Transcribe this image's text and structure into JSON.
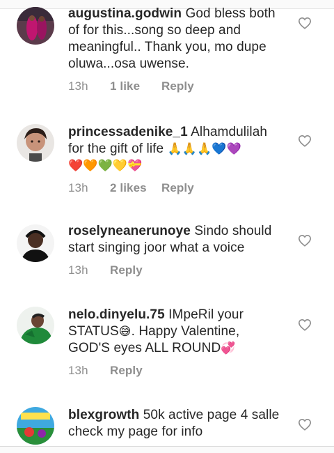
{
  "comments": [
    {
      "username": "augustina.godwin",
      "text": "God bless both of for this...song so deep and meaningful.. Thank  you, mo dupe oluwa...osa uwense.",
      "time": "13h",
      "likes": "1 like",
      "reply": "Reply"
    },
    {
      "username": "princessadenike_1",
      "text": "Alhamdulilah for the gift of life ",
      "emojis": "🙏🙏🙏💙💜",
      "emojis2": "❤️🧡💚💛💝",
      "time": "13h",
      "likes": "2 likes",
      "reply": "Reply"
    },
    {
      "username": "roselyneanerunoye",
      "text": "Sindo should start singing joor what a voice",
      "time": "13h",
      "likes": "",
      "reply": "Reply"
    },
    {
      "username": "nelo.dinyelu.75",
      "text": "IMpeRil your STATUS",
      "emoji_a": "😅",
      "text_b": ". Happy Valentine, GOD'S eyes ALL ROUND",
      "emoji_b": "💞",
      "time": "13h",
      "likes": "",
      "reply": "Reply"
    },
    {
      "username": "blexgrowth",
      "text": "50k active page 4 salle check my page for info",
      "time": "",
      "likes": "",
      "reply": ""
    }
  ],
  "icons": {
    "like": "heart-outline-icon"
  },
  "colors": {
    "text": "#262626",
    "meta": "#8e8e8e",
    "heart": "#8e8e8e"
  }
}
